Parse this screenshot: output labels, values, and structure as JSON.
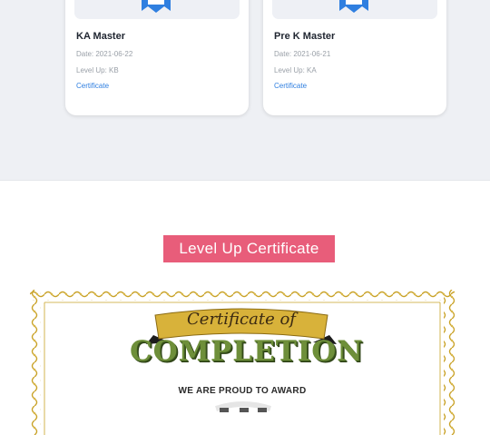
{
  "cards": [
    {
      "title": "KA Master",
      "date": "Date: 2021-06-22",
      "level": "Level Up: KB",
      "link": "Certificate"
    },
    {
      "title": "Pre K Master",
      "date": "Date: 2021-06-21",
      "level": "Level Up: KA",
      "link": "Certificate"
    }
  ],
  "section": {
    "heading": "Level Up Certificate"
  },
  "certificate": {
    "script_text": "Certificate of",
    "title": "COMPLETION",
    "award_text": "WE ARE PROUD TO AWARD"
  },
  "colors": {
    "heading_bg": "#e85d7a",
    "link": "#2f7fe0",
    "badge": "#2f7fe0",
    "gold": "#c9a227",
    "completion_green": "#6e8f3a"
  },
  "icons": {
    "card_badge": "ribbon-badge-icon"
  }
}
